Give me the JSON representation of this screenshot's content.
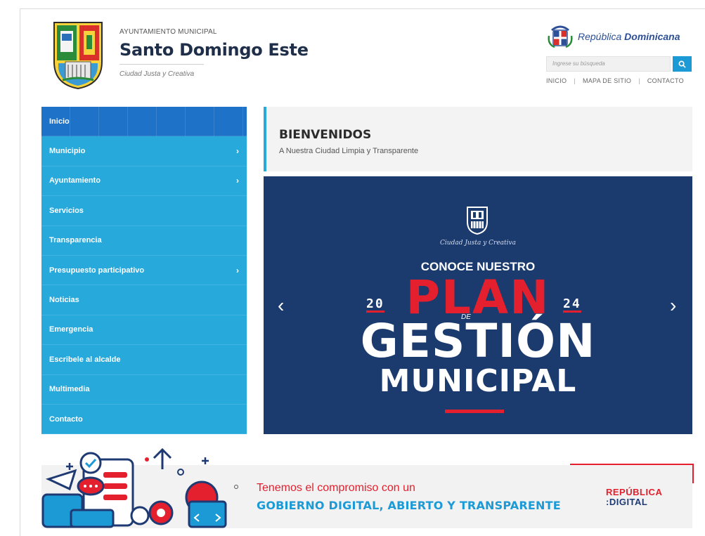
{
  "header": {
    "org_small": "AYUNTAMIENTO MUNICIPAL",
    "org_title": "Santo Domingo Este",
    "org_tagline": "Ciudad Justa y Creativa",
    "rd_prefix": "República",
    "rd_bold": "Dominicana",
    "search_placeholder": "Ingrese su búsqueda",
    "top_links": [
      "INICIO",
      "MAPA DE SITIO",
      "CONTACTO"
    ],
    "separator": "|"
  },
  "sidebar": {
    "items": [
      {
        "label": "Inicio",
        "active": true,
        "has_children": false
      },
      {
        "label": "Municipio",
        "active": false,
        "has_children": true
      },
      {
        "label": "Ayuntamiento",
        "active": false,
        "has_children": true
      },
      {
        "label": "Servicios",
        "active": false,
        "has_children": false
      },
      {
        "label": "Transparencia",
        "active": false,
        "has_children": false
      },
      {
        "label": "Presupuesto participativo",
        "active": false,
        "has_children": true
      },
      {
        "label": "Noticias",
        "active": false,
        "has_children": false
      },
      {
        "label": "Emergencia",
        "active": false,
        "has_children": false
      },
      {
        "label": "Escribele al alcalde",
        "active": false,
        "has_children": false
      },
      {
        "label": "Multimedia",
        "active": false,
        "has_children": false
      },
      {
        "label": "Contacto",
        "active": false,
        "has_children": false
      }
    ],
    "chevron": "›"
  },
  "welcome": {
    "title": "BIENVENIDOS",
    "subtitle": "A Nuestra Ciudad Limpia y Transparente"
  },
  "banner": {
    "motto": "Ciudad Justa y Creativa",
    "heading": "CONOCE NUESTRO",
    "year_left": "20",
    "plan": "PLAN",
    "year_right": "24",
    "de": "DE",
    "gestion": "GESTIÓN",
    "municipal": "MUNICIPAL",
    "prev": "‹",
    "next": "›"
  },
  "strip": {
    "line1": "Tenemos el compromiso con un",
    "line2": "GOBIERNO DIGITAL, ABIERTO Y TRANSPARENTE",
    "rd_digital_top": "REPÚBLICA",
    "rd_digital_bottom": ":DIGITAL"
  },
  "colors": {
    "sidebar_bg": "#27a9dc",
    "sidebar_active": "#1e72c7",
    "banner_bg": "#1b3a6e",
    "accent_red": "#e4202e",
    "accent_blue": "#1c9ad6"
  }
}
